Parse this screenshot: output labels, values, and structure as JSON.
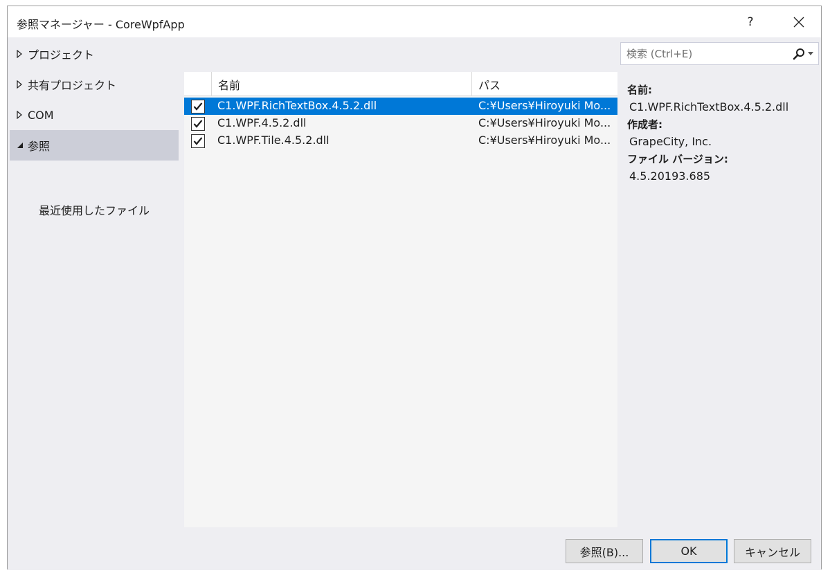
{
  "window": {
    "title": "参照マネージャー - CoreWpfApp"
  },
  "titlebar": {
    "help_label": "?"
  },
  "nav": {
    "items": [
      {
        "label": "プロジェクト",
        "expanded": false
      },
      {
        "label": "共有プロジェクト",
        "expanded": false
      },
      {
        "label": "COM",
        "expanded": false
      },
      {
        "label": "参照",
        "expanded": true,
        "selected": true
      }
    ],
    "subitem": "最近使用したファイル"
  },
  "search": {
    "placeholder": "検索 (Ctrl+E)",
    "value": ""
  },
  "list": {
    "columns": {
      "name": "名前",
      "path": "パス"
    },
    "rows": [
      {
        "checked": true,
        "name": "C1.WPF.RichTextBox.4.5.2.dll",
        "path": "C:¥Users¥Hiroyuki Mo...",
        "selected": true
      },
      {
        "checked": true,
        "name": "C1.WPF.4.5.2.dll",
        "path": "C:¥Users¥Hiroyuki Mo...",
        "selected": false
      },
      {
        "checked": true,
        "name": "C1.WPF.Tile.4.5.2.dll",
        "path": "C:¥Users¥Hiroyuki Mo...",
        "selected": false
      }
    ]
  },
  "details": {
    "name_label": "名前:",
    "name_value": "C1.WPF.RichTextBox.4.5.2.dll",
    "author_label": "作成者:",
    "author_value": "GrapeCity, Inc.",
    "version_label": "ファイル バージョン:",
    "version_value": "4.5.20193.685"
  },
  "buttons": {
    "browse": "参照(B)...",
    "ok": "OK",
    "cancel": "キャンセル"
  },
  "colors": {
    "accent": "#0078d7",
    "nav_selected": "#ccced8",
    "window_bg": "#eeeef2"
  },
  "icons": {
    "collapsed": "triangle-right-outline-icon",
    "expanded": "triangle-down-filled-icon",
    "search": "magnifier-icon",
    "dropdown": "chevron-down-icon",
    "close": "close-x-icon",
    "check": "checkmark-icon"
  }
}
